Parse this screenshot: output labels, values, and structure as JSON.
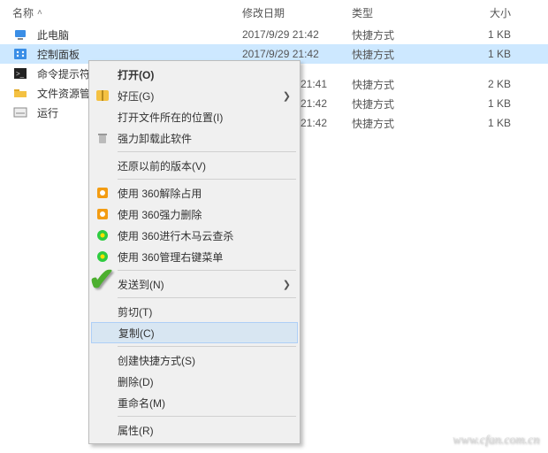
{
  "columns": {
    "name": "名称",
    "date": "修改日期",
    "type": "类型",
    "size": "大小"
  },
  "files": [
    {
      "name": "此电脑",
      "date": "2017/9/29 21:42",
      "type": "快捷方式",
      "size": "1 KB",
      "icon": "pc",
      "selected": false
    },
    {
      "name": "控制面板",
      "date": "2017/9/29 21:42",
      "type": "快捷方式",
      "size": "1 KB",
      "icon": "control",
      "selected": true
    },
    {
      "name": "命令提示符",
      "date": "",
      "type": "",
      "size": "",
      "icon": "cmd",
      "selected": false,
      "cut": true
    },
    {
      "name": "文件资源管",
      "date": "",
      "type": "",
      "size": "",
      "icon": "explorer",
      "selected": false,
      "cut": true
    },
    {
      "name": "运行",
      "date": "",
      "type": "",
      "size": "",
      "icon": "run",
      "selected": false,
      "cut": true
    }
  ],
  "partial": [
    {
      "date": "21:41",
      "type": "快捷方式",
      "size": "2 KB"
    },
    {
      "date": "21:42",
      "type": "快捷方式",
      "size": "1 KB"
    },
    {
      "date": "21:42",
      "type": "快捷方式",
      "size": "1 KB"
    }
  ],
  "menu": [
    {
      "kind": "item",
      "label": "打开(O)",
      "icon": "",
      "bold": true
    },
    {
      "kind": "item",
      "label": "好压(G)",
      "icon": "haozip",
      "sub": true
    },
    {
      "kind": "item",
      "label": "打开文件所在的位置(I)",
      "icon": ""
    },
    {
      "kind": "item",
      "label": "强力卸载此软件",
      "icon": "uninstall"
    },
    {
      "kind": "sep"
    },
    {
      "kind": "item",
      "label": "还原以前的版本(V)",
      "icon": ""
    },
    {
      "kind": "sep"
    },
    {
      "kind": "item",
      "label": "使用 360解除占用",
      "icon": "360orange"
    },
    {
      "kind": "item",
      "label": "使用 360强力删除",
      "icon": "360orange"
    },
    {
      "kind": "item",
      "label": "使用 360进行木马云查杀",
      "icon": "360green"
    },
    {
      "kind": "item",
      "label": "使用 360管理右键菜单",
      "icon": "360green"
    },
    {
      "kind": "sep"
    },
    {
      "kind": "item",
      "label": "发送到(N)",
      "icon": "",
      "sub": true
    },
    {
      "kind": "sep"
    },
    {
      "kind": "item",
      "label": "剪切(T)",
      "icon": ""
    },
    {
      "kind": "item",
      "label": "复制(C)",
      "icon": "",
      "hl": true
    },
    {
      "kind": "sep"
    },
    {
      "kind": "item",
      "label": "创建快捷方式(S)",
      "icon": ""
    },
    {
      "kind": "item",
      "label": "删除(D)",
      "icon": ""
    },
    {
      "kind": "item",
      "label": "重命名(M)",
      "icon": ""
    },
    {
      "kind": "sep"
    },
    {
      "kind": "item",
      "label": "属性(R)",
      "icon": ""
    }
  ],
  "watermark": "www.cfan.com.cn",
  "arrow_glyph": "❯",
  "sort_caret": "˄"
}
